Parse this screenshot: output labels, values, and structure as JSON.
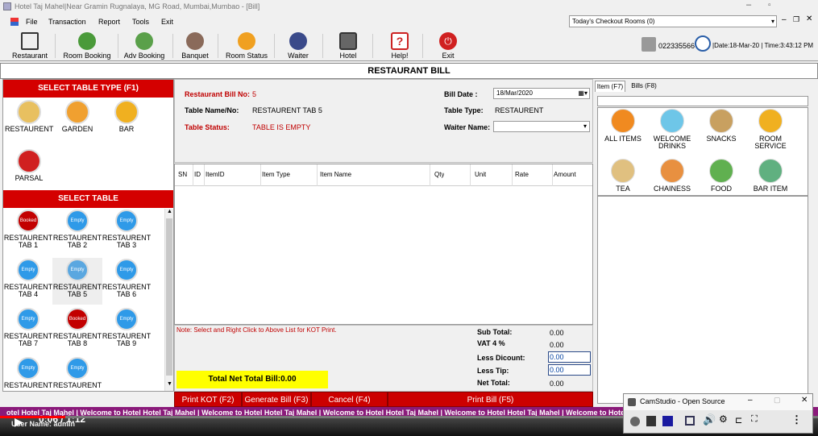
{
  "window": {
    "title": "Hotel Taj Mahel|Near Gramin Rugnalaya, MG Road, Mumbai,Mumbao - [Bill]"
  },
  "menu": [
    "File",
    "Transaction",
    "Report",
    "Tools",
    "Exit"
  ],
  "toolbar": [
    "Restaurant",
    "Room Booking",
    "Adv Booking",
    "Banquet",
    "Room Status",
    "Waiter",
    "Hotel",
    "Help!",
    "Exit"
  ],
  "checkout": {
    "value": "Today's Checkout Rooms (0)"
  },
  "status": {
    "phone": "022335566",
    "date": "|Date:18-Mar-20 | Time:3:43:12 PM"
  },
  "header": "RESTAURANT BILL",
  "table_type": {
    "title": "SELECT TABLE TYPE (F1)",
    "items": [
      "RESTAURENT",
      "GARDEN",
      "BAR",
      "PARSAL"
    ]
  },
  "select_table": {
    "title": "SELECT TABLE",
    "items": [
      {
        "badge": "Booked",
        "l1": "RESTAURENT",
        "l2": "TAB 1",
        "color": "#c20000"
      },
      {
        "badge": "Empty",
        "l1": "RESTAURENT",
        "l2": "TAB 2",
        "color": "#2f9ae8"
      },
      {
        "badge": "Empty",
        "l1": "RESTAURENT",
        "l2": "TAB 3",
        "color": "#2f9ae8"
      },
      {
        "badge": "Empty",
        "l1": "RESTAURENT",
        "l2": "TAB 4",
        "color": "#2f9ae8"
      },
      {
        "badge": "Empty",
        "l1": "RESTAURENT",
        "l2": "TAB 5",
        "color": "#5aa7e0"
      },
      {
        "badge": "Empty",
        "l1": "RESTAURENT",
        "l2": "TAB 6",
        "color": "#2f9ae8"
      },
      {
        "badge": "Empty",
        "l1": "RESTAURENT",
        "l2": "TAB 7",
        "color": "#2f9ae8"
      },
      {
        "badge": "Booked",
        "l1": "RESTAURENT",
        "l2": "TAB 8",
        "color": "#c20000"
      },
      {
        "badge": "Empty",
        "l1": "RESTAURENT",
        "l2": "TAB 9",
        "color": "#2f9ae8"
      },
      {
        "badge": "Empty",
        "l1": "RESTAURENT",
        "l2": "",
        "color": "#2f9ae8"
      },
      {
        "badge": "Empty",
        "l1": "RESTAURENT",
        "l2": "",
        "color": "#2f9ae8"
      }
    ]
  },
  "bill": {
    "no_label": "Restaurant Bill No:",
    "no": "5",
    "table_label": "Table Name/No:",
    "table": "RESTAURENT  TAB 5",
    "status_label": "Table Status:",
    "status": "TABLE IS EMPTY",
    "date_label": "Bill Date :",
    "date": "18/Mar/2020",
    "type_label": "Table Type:",
    "type": "RESTAURENT",
    "waiter_label": "Waiter Name:"
  },
  "grid": {
    "columns": [
      "SN",
      "ID",
      "ItemID",
      "Item Type",
      "Item Name",
      "Qty",
      "Unit",
      "Rate",
      "Amount"
    ]
  },
  "note": "Note: Select and Right Click to Above List for KOT Print.",
  "totals": {
    "sub_label": "Sub Total:",
    "sub": "0.00",
    "vat_label": "VAT 4 %",
    "vat": "0.00",
    "disc_label": "Less Dicount:",
    "disc": "0.00",
    "tip_label": "Less Tip:",
    "tip": "0.00",
    "net_label": "Net Total:",
    "net": "0.00"
  },
  "net_total_bill": "Total Net Total Bill:0.00",
  "buttons": {
    "kot": "Print KOT (F2)",
    "gen": "Generate Bill (F3)",
    "cancel": "Cancel (F4)",
    "print": "Print Bill (F5)"
  },
  "tabs": [
    "Item (F7)",
    "Bills (F8)"
  ],
  "categories": [
    {
      "l1": "ALL ITEMS",
      "l2": "",
      "color": "#f08a20"
    },
    {
      "l1": "WELCOME",
      "l2": "DRINKS",
      "color": "#6ec6e8"
    },
    {
      "l1": "SNACKS",
      "l2": "",
      "color": "#c8a060"
    },
    {
      "l1": "ROOM",
      "l2": "SERVICE",
      "color": "#f0b020"
    },
    {
      "l1": "TEA",
      "l2": "",
      "color": "#e0c080"
    },
    {
      "l1": "CHAINESS",
      "l2": "",
      "color": "#e89040"
    },
    {
      "l1": "FOOD",
      "l2": "",
      "color": "#60b050"
    },
    {
      "l1": "BAR ITEM",
      "l2": "",
      "color": "#60b080"
    }
  ],
  "marquee": "otel Hotel Taj Mahel |   Welcome to Hotel Hotel Taj Mahel |   Welcome to Hotel Hotel Taj Mahel |   Welcome to Hotel Hotel Taj Mahel |   Welcome to Hotel Hotel Taj Mahel |   Welcome to Hotel Hotel Ta",
  "user": "User Name: admin",
  "video": {
    "time": "0:06 / 1:12"
  },
  "camstudio": {
    "title": "CamStudio - Open Source"
  }
}
